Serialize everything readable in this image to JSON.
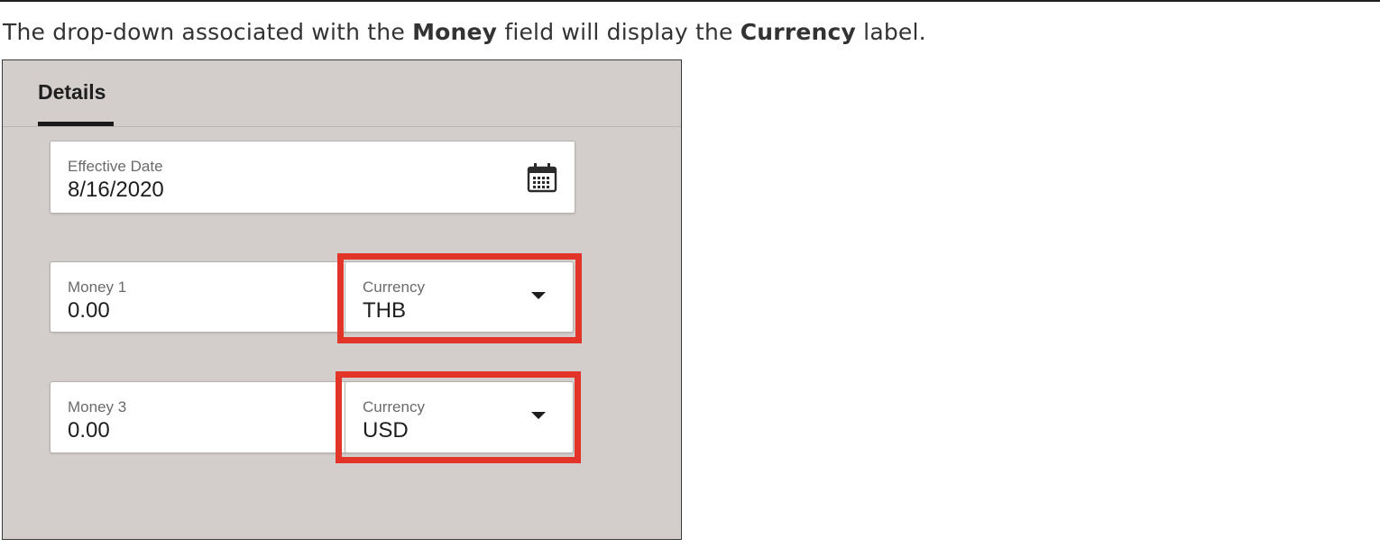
{
  "caption": {
    "part1": "The drop-down associated with the ",
    "bold1": "Money",
    "part2": " field will display the ",
    "bold2": "Currency",
    "part3": " label."
  },
  "details_panel": {
    "tab_label": "Details",
    "effective_date": {
      "label": "Effective Date",
      "value": "8/16/2020",
      "icon": "calendar-icon"
    },
    "money_rows": [
      {
        "label": "Money 1",
        "value": "0.00",
        "currency_label": "Currency",
        "currency_value": "THB"
      },
      {
        "label": "Money 3",
        "value": "0.00",
        "currency_label": "Currency",
        "currency_value": "USD"
      }
    ]
  },
  "colors": {
    "panel_background": "#d3cecc",
    "highlight": "#e3342a",
    "field_background": "#ffffff"
  }
}
